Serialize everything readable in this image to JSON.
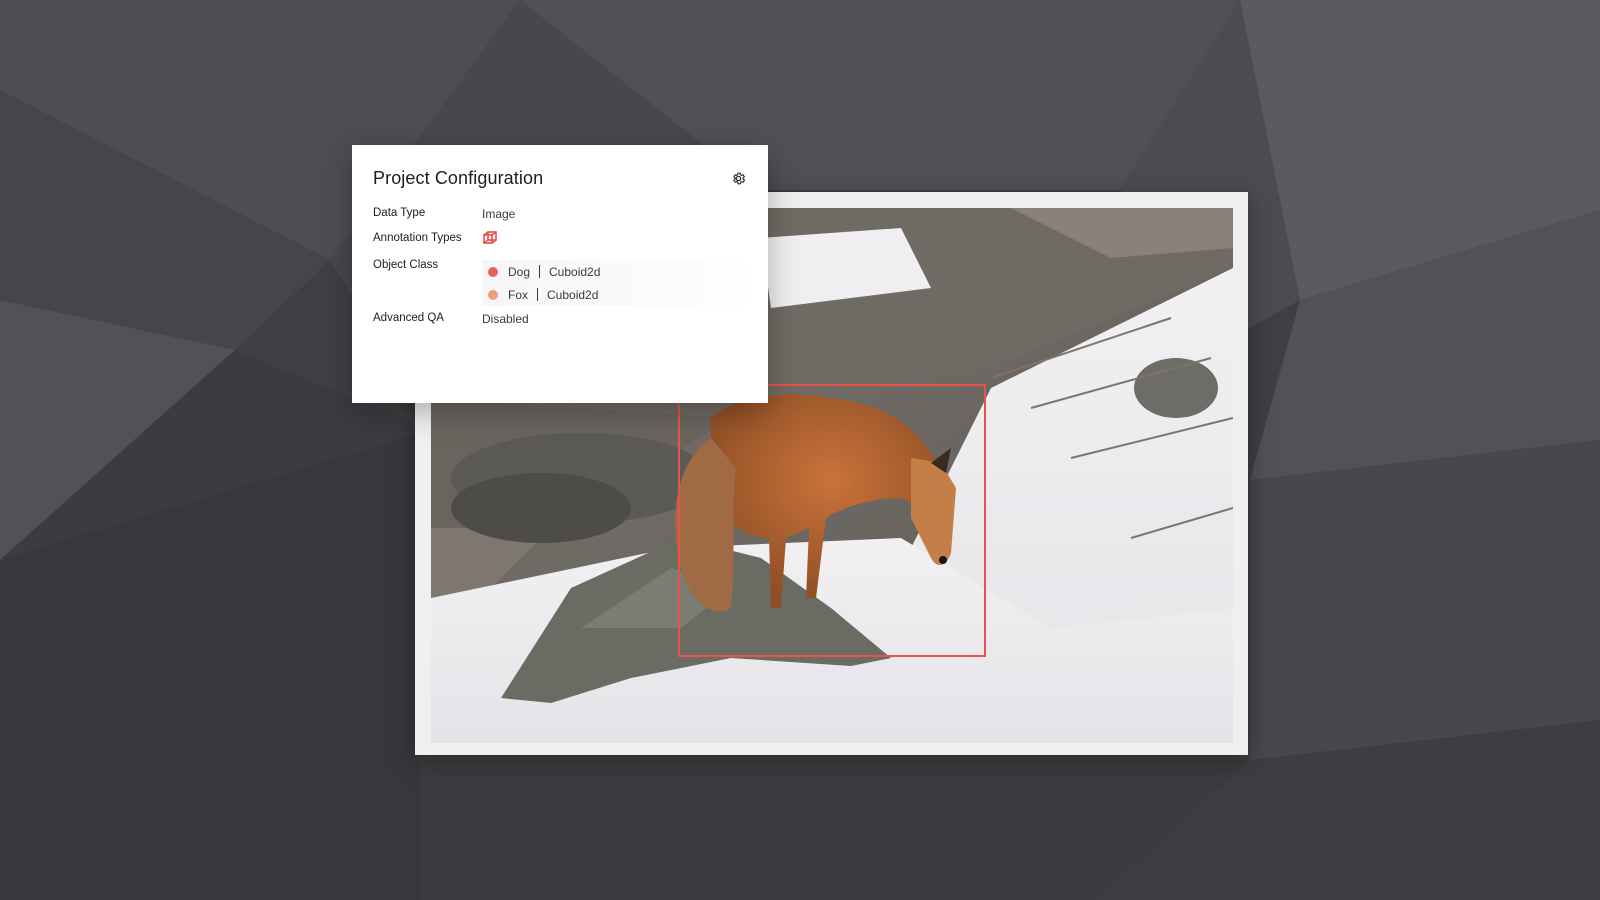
{
  "colors": {
    "background": "#3f4043",
    "accent": "#e8524a",
    "dog_class": "#e8635a",
    "fox_class": "#ef9c80"
  },
  "panel": {
    "title": "Project Configuration",
    "settings_icon": "gear-icon",
    "rows": {
      "data_type": {
        "label": "Data Type",
        "value": "Image"
      },
      "annotation_types": {
        "label": "Annotation Types",
        "icon": "cuboid-icon"
      },
      "object_class": {
        "label": "Object Class",
        "items": [
          {
            "name": "Dog",
            "type": "Cuboid2d",
            "color": "#e8635a"
          },
          {
            "name": "Fox",
            "type": "Cuboid2d",
            "color": "#ef9c80"
          }
        ]
      },
      "advanced_qa": {
        "label": "Advanced QA",
        "value": "Disabled"
      }
    }
  },
  "image": {
    "subject": "fox-in-snow-photo",
    "annotation": "bounding-box"
  }
}
